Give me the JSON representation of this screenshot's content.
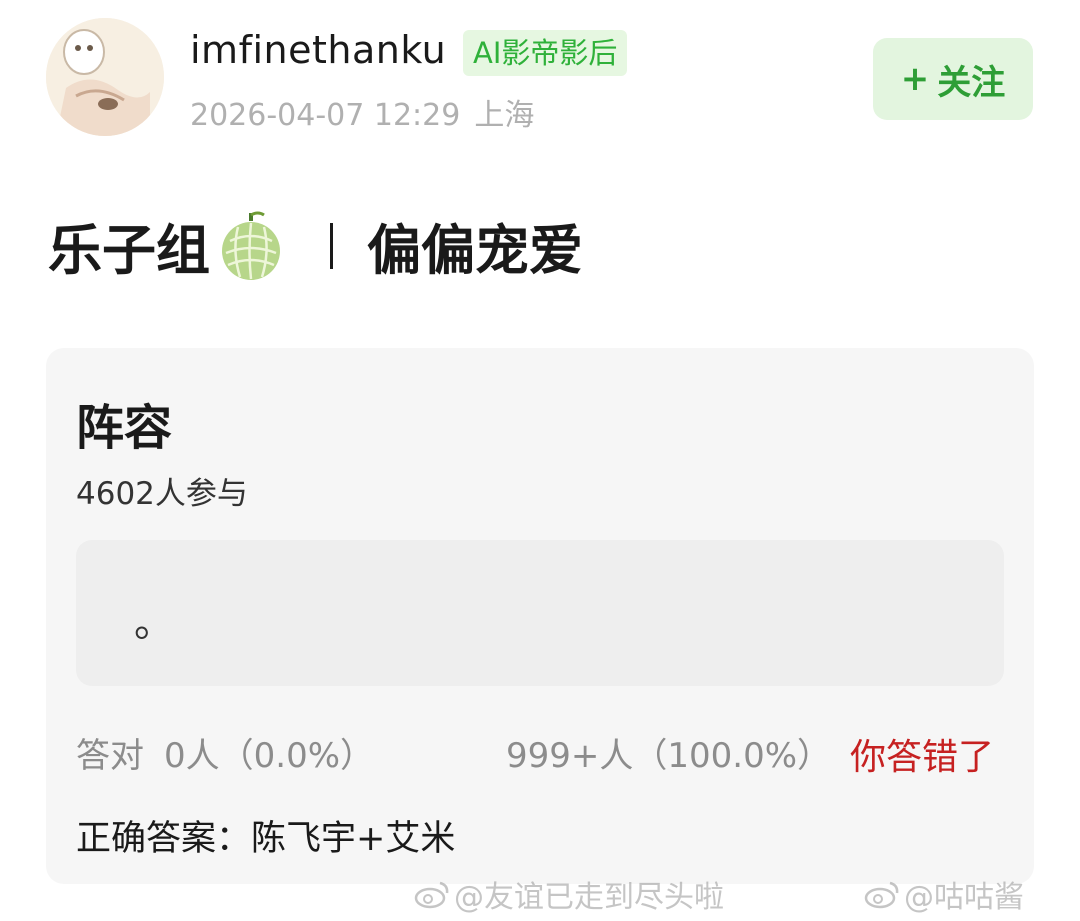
{
  "header": {
    "username": "imfinethanku",
    "tag": "AI影帝影后",
    "date": "2026-04-07 12:29",
    "location": "上海",
    "follow_plus": "+",
    "follow_label": "关注"
  },
  "post": {
    "title_left": "乐子组",
    "title_emoji": "melon-icon",
    "title_right": "偏偏宠爱"
  },
  "quiz": {
    "title": "阵容",
    "participants": "4602人参与",
    "option_text": "。",
    "correct_label": "答对",
    "correct_count": "0人（0.0%）",
    "wrong_count": "999+人（100.0%）",
    "wrong_label": "你答错了",
    "answer": "正确答案：陈飞宇+艾米"
  },
  "watermarks": {
    "left": "@友谊已走到尽头啦",
    "right": "@咕咕酱"
  },
  "colors": {
    "accent_green": "#2fb13a",
    "wrong_red": "#c62121",
    "card_bg": "#f6f6f6"
  }
}
